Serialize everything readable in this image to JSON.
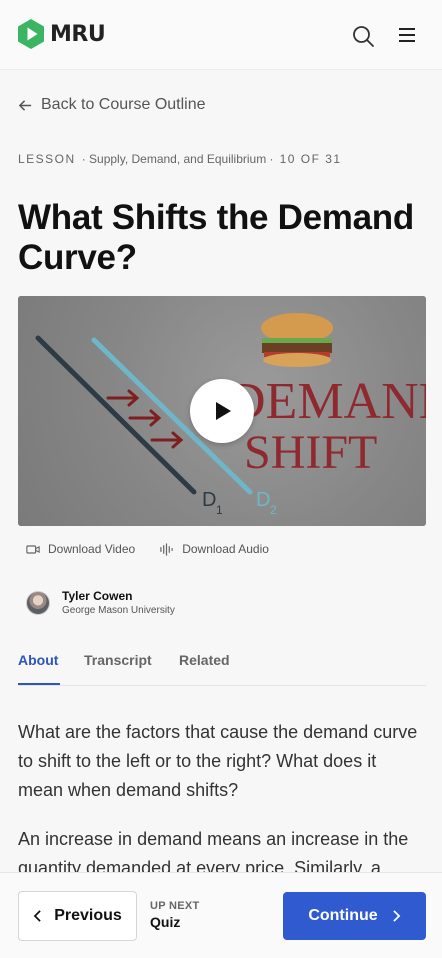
{
  "header": {
    "logo_text": "MRU",
    "brand_color": "#3cb563",
    "search_icon": "search-icon",
    "menu_icon": "hamburger-menu-icon"
  },
  "back_link": {
    "label": "Back to Course Outline",
    "icon": "arrow-left-icon"
  },
  "meta": {
    "lesson": "LESSON",
    "course": "· Supply, Demand, and Equilibrium ·",
    "count": "10 OF 31"
  },
  "title": "What Shifts the Demand Curve?",
  "video": {
    "thumbnail_text_line1": "DEMAND",
    "thumbnail_text_line2": "SHIFT",
    "curve_label_1": "D",
    "curve_sub_1": "1",
    "curve_label_2": "D",
    "curve_sub_2": "2",
    "play_icon": "play-icon"
  },
  "downloads": {
    "video_label": "Download Video",
    "audio_label": "Download Audio"
  },
  "author": {
    "name": "Tyler Cowen",
    "org": "George Mason University"
  },
  "tabs": [
    {
      "label": "About"
    },
    {
      "label": "Transcript"
    },
    {
      "label": "Related"
    }
  ],
  "about": {
    "paragraph1": "What are the factors that cause the demand curve to shift to the left or to the right? What does it mean when demand shifts?",
    "paragraph2": "An increase in demand means an increase in the quantity demanded at every price. Similarly, a"
  },
  "footer": {
    "previous_label": "Previous",
    "upnext_label": "UP NEXT",
    "upnext_value": "Quiz",
    "continue_label": "Continue",
    "accent_color": "#2f5ad0"
  }
}
